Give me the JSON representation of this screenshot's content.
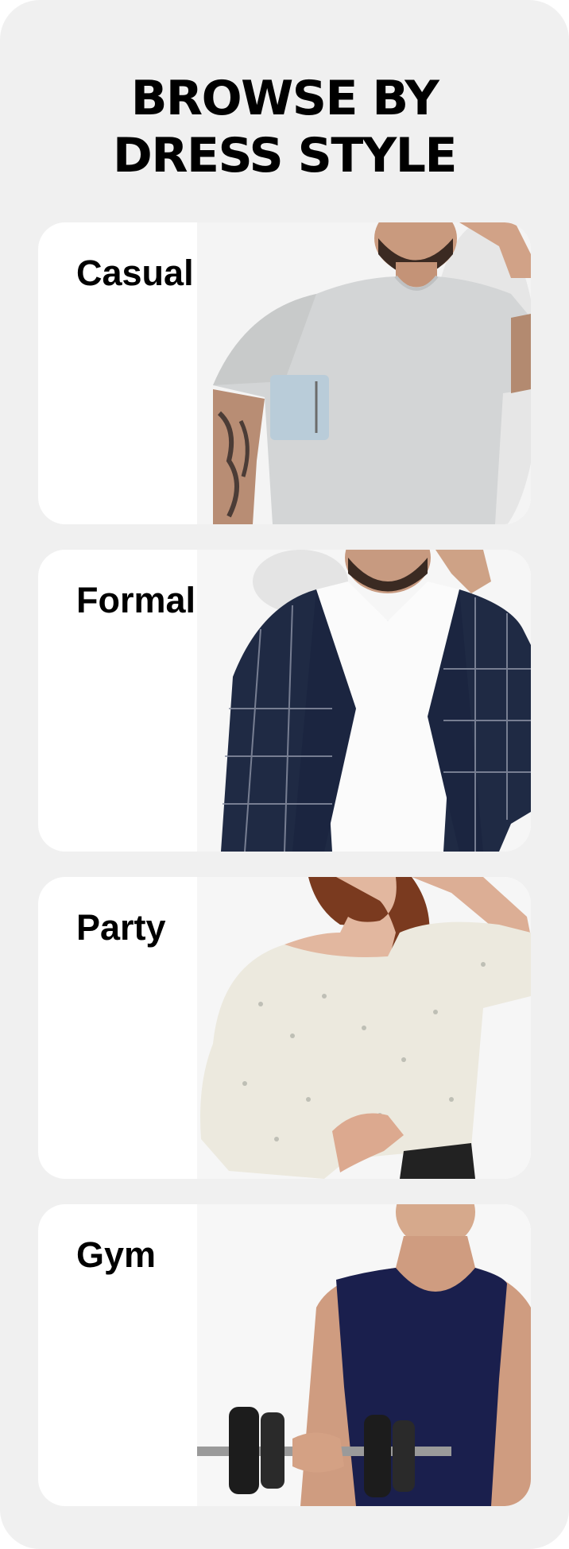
{
  "section": {
    "title_line1": "BROWSE BY",
    "title_line2": "DRESS STYLE"
  },
  "styles": [
    {
      "label": "Casual"
    },
    {
      "label": "Formal"
    },
    {
      "label": "Party"
    },
    {
      "label": "Gym"
    }
  ]
}
